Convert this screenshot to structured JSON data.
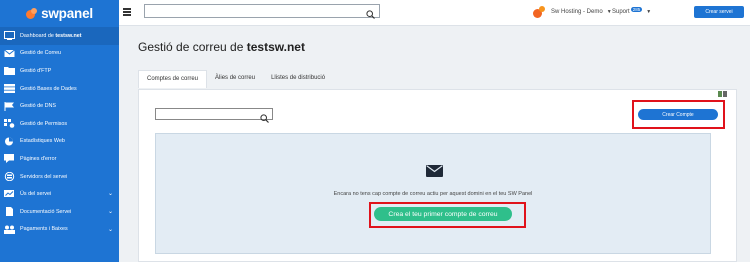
{
  "brand": {
    "name": "swpanel"
  },
  "sidebar": {
    "items": [
      {
        "label_prefix": "Dashboard de ",
        "label_bold": "testsw.net",
        "icon": "dashboard-icon"
      },
      {
        "label": "Gestió de Correu",
        "icon": "envelope-icon"
      },
      {
        "label": "Gestió d'FTP",
        "icon": "folder-icon"
      },
      {
        "label": "Gestió Bases de Dades",
        "icon": "database-icon"
      },
      {
        "label": "Gestió de DNS",
        "icon": "flag-icon"
      },
      {
        "label": "Gestió de Permisos",
        "icon": "permissions-icon"
      },
      {
        "label": "Estadístiques Web",
        "icon": "pie-chart-icon"
      },
      {
        "label": "Pàgines d'error",
        "icon": "chat-icon"
      },
      {
        "label": "Servidors del servei",
        "icon": "server-icon"
      },
      {
        "label": "Ús del servei",
        "icon": "usage-icon"
      },
      {
        "label": "Documentació Servei",
        "icon": "document-icon"
      },
      {
        "label": "Pagaments i Baixes",
        "icon": "users-icon"
      }
    ]
  },
  "topbar": {
    "search_value": "",
    "account_label": "Sw Hosting - Demo",
    "support_label": "Suport",
    "support_badge": "285",
    "create_service_label": "Crear servei"
  },
  "main": {
    "title_prefix": "Gestió de correu de ",
    "title_domain": "testsw.net",
    "tabs": [
      {
        "label": "Comptes de correu",
        "active": true
      },
      {
        "label": "Àlies de correu",
        "active": false
      },
      {
        "label": "Llistes de distribució",
        "active": false
      }
    ],
    "search_value": "",
    "create_account_label": "Crear Compte",
    "empty_message": "Encara no tens cap compte de correu actiu per aquest domini en el teu SW Panel",
    "first_account_label": "Crea el teu primer compte de correu"
  },
  "colors": {
    "sidebar": "#1e74d3",
    "primary": "#1e74d3",
    "success": "#2fbf8b",
    "highlight": "#e0121b",
    "brand_orange": "#f26522"
  }
}
